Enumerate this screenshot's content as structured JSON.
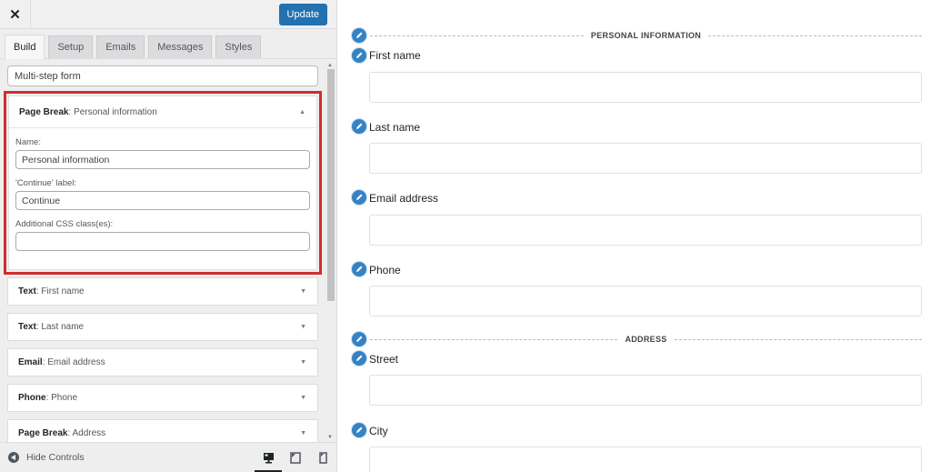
{
  "header": {
    "close_icon": "close-icon",
    "update_label": "Update"
  },
  "tabs": [
    {
      "label": "Build",
      "active": true
    },
    {
      "label": "Setup",
      "active": false
    },
    {
      "label": "Emails",
      "active": false
    },
    {
      "label": "Messages",
      "active": false
    },
    {
      "label": "Styles",
      "active": false
    }
  ],
  "form_name_value": "Multi-step form",
  "expanded_field": {
    "type": "Page Break",
    "name": "Personal information",
    "fields": {
      "name_label": "Name:",
      "name_value": "Personal information",
      "continue_label": "'Continue' label:",
      "continue_value": "Continue",
      "css_label": "Additional CSS class(es):",
      "css_value": ""
    }
  },
  "fields": [
    {
      "type": "Text",
      "name": "First name"
    },
    {
      "type": "Text",
      "name": "Last name"
    },
    {
      "type": "Email",
      "name": "Email address"
    },
    {
      "type": "Phone",
      "name": "Phone"
    },
    {
      "type": "Page Break",
      "name": "Address"
    }
  ],
  "footer": {
    "hide_controls_label": "Hide Controls",
    "devices": [
      "desktop",
      "tablet",
      "mobile"
    ],
    "active_device": "desktop"
  },
  "preview": {
    "sections": [
      {
        "title": "PERSONAL INFORMATION"
      },
      {
        "title": "ADDRESS"
      }
    ],
    "labels": {
      "first_name": "First name",
      "last_name": "Last name",
      "email": "Email address",
      "phone": "Phone",
      "street": "Street",
      "city": "City"
    }
  },
  "colors": {
    "accent": "#2271b1",
    "highlight": "#cf2e2e",
    "edit_icon": "#3582c4"
  }
}
